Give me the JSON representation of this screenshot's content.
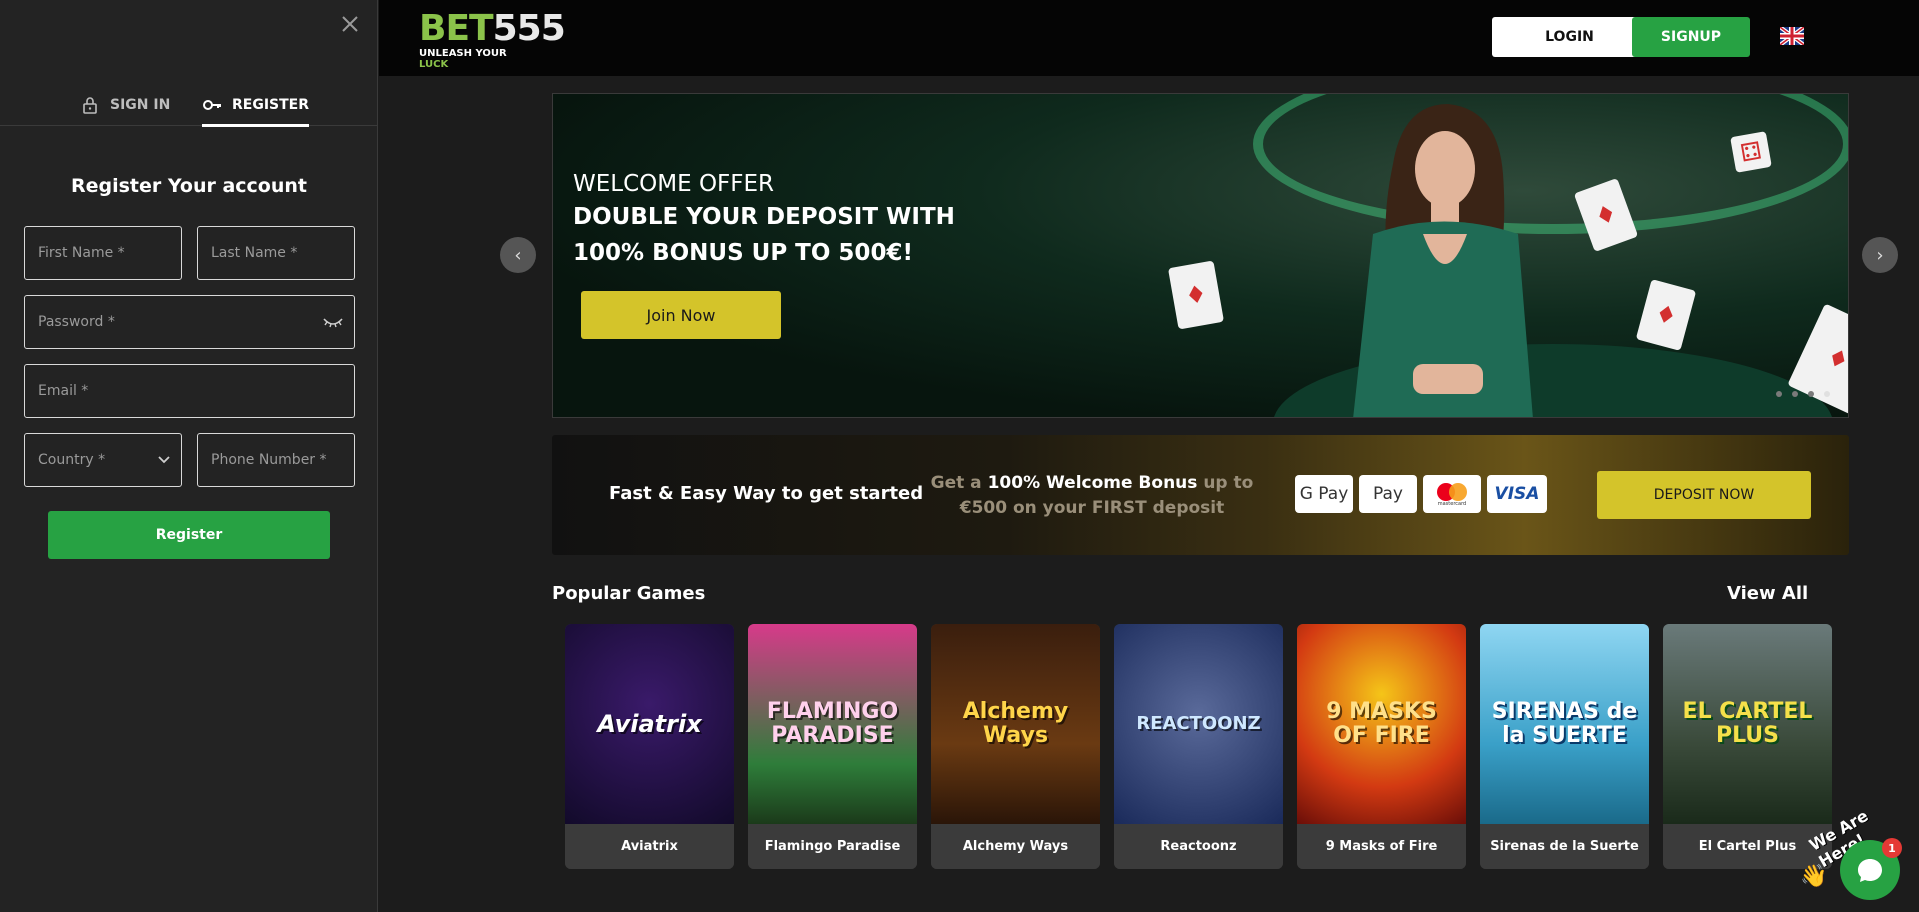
{
  "sidebar": {
    "tabs": [
      {
        "label": "SIGN IN",
        "icon": "lock-icon"
      },
      {
        "label": "REGISTER",
        "icon": "key-icon"
      }
    ],
    "form_title": "Register Your account",
    "fields": {
      "first_name": "First Name *",
      "last_name": "Last Name *",
      "password": "Password *",
      "email": "Email *",
      "country": "Country *",
      "phone": "Phone Number *"
    },
    "register_label": "Register"
  },
  "header": {
    "logo_main_b": "BET",
    "logo_main_r": "555",
    "logo_tag_pre": "UNLEASH YOUR ",
    "logo_tag_accent": "LUCK",
    "login_label": "LOGIN",
    "signup_label": "SIGNUP",
    "language_icon": "uk-flag-icon"
  },
  "hero": {
    "line1": "WELCOME OFFER",
    "line2": "DOUBLE YOUR DEPOSIT WITH",
    "line3": "100% BONUS UP TO 500€!",
    "cta": "Join Now"
  },
  "deposit": {
    "lead": "Fast & Easy Way to get started",
    "promo_pre": "Get a ",
    "promo_bold": "100% Welcome Bonus",
    "promo_post": " up to €500 on your FIRST deposit",
    "payments": [
      "G Pay",
      "Pay",
      "mastercard",
      "VISA"
    ],
    "cta": "DEPOSIT NOW"
  },
  "games": {
    "title": "Popular Games",
    "view_all": "View All",
    "items": [
      {
        "name": "Aviatrix",
        "art": "Aviatrix"
      },
      {
        "name": "Flamingo Paradise",
        "art": "FLAMINGO PARADISE"
      },
      {
        "name": "Alchemy Ways",
        "art": "Alchemy Ways"
      },
      {
        "name": "Reactoonz",
        "art": "REACTOONZ"
      },
      {
        "name": "9 Masks of Fire",
        "art": "9 MASKS OF FIRE"
      },
      {
        "name": "Sirenas de la Suerte",
        "art": "SIRENAS de la SUERTE"
      },
      {
        "name": "El Cartel Plus",
        "art": "EL CARTEL PLUS"
      }
    ]
  },
  "chat": {
    "tagline": "We Are Here!",
    "badge_count": "1"
  },
  "colors": {
    "accent_green": "#27a243",
    "accent_yellow": "#d4c42a",
    "background": "#1c1c1c"
  }
}
